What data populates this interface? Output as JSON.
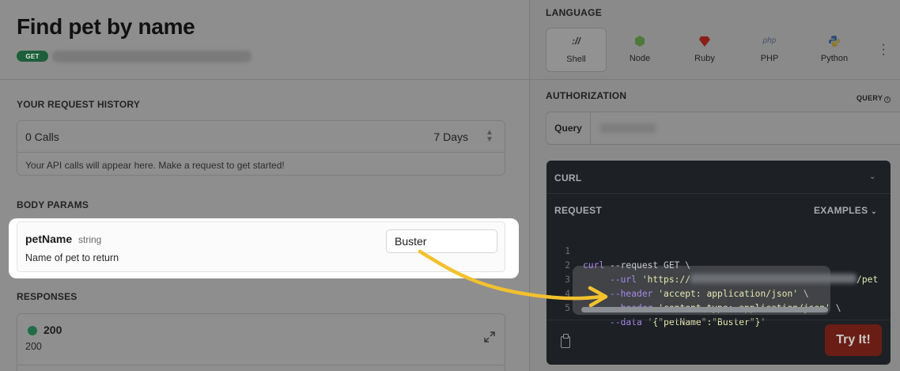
{
  "page": {
    "title": "Find pet by name",
    "method_badge": "GET"
  },
  "history": {
    "section_label": "YOUR REQUEST HISTORY",
    "calls": "0 Calls",
    "range": "7 Days",
    "note": "Your API calls will appear here. Make a request to get started!"
  },
  "body_params": {
    "section_label": "BODY PARAMS",
    "param": {
      "name": "petName",
      "type": "string",
      "description": "Name of pet to return",
      "value": "Buster"
    }
  },
  "responses": {
    "section_label": "RESPONSES",
    "items": [
      {
        "code": "200",
        "description": "200",
        "status_color": "#1f6d46"
      }
    ]
  },
  "language": {
    "section_label": "LANGUAGE",
    "options": [
      {
        "name": "Shell",
        "icon": "shell-icon",
        "active": true
      },
      {
        "name": "Node",
        "icon": "node-icon"
      },
      {
        "name": "Ruby",
        "icon": "ruby-icon"
      },
      {
        "name": "PHP",
        "icon": "php-icon",
        "icon_text": "php"
      },
      {
        "name": "Python",
        "icon": "python-icon"
      }
    ]
  },
  "authorization": {
    "section_label": "AUTHORIZATION",
    "type_label": "QUERY",
    "field_label": "Query"
  },
  "code_panel": {
    "curl_label": "CURL",
    "request_label": "REQUEST",
    "examples_label": "EXAMPLES",
    "try_button": "Try It!",
    "try_button_color": "#6a1d14",
    "lines": [
      {
        "n": "1",
        "cmd": "curl",
        "rest": " --request GET \\"
      },
      {
        "n": "2",
        "flag": "--url",
        "str": " 'https://",
        "tail": "/pet"
      },
      {
        "n": "3",
        "flag": "--header",
        "str": " 'accept: application/json'",
        "end": " \\"
      },
      {
        "n": "4",
        "flag": "--header",
        "str": " 'content-type: application/json'",
        "end": " \\"
      },
      {
        "n": "5",
        "flag": "--data",
        "str": " '{\"petName\":\"Buster\"}'"
      }
    ]
  },
  "annotation": {
    "arrow_color": "#f2c12e"
  }
}
